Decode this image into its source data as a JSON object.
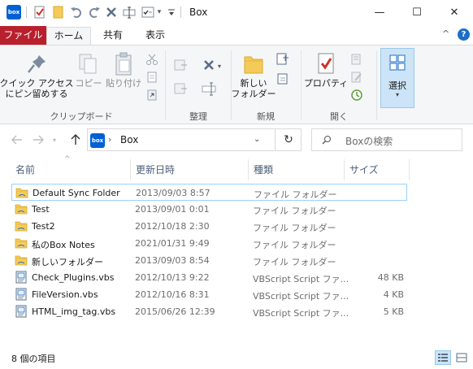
{
  "window": {
    "title": "Box",
    "minimize": "—",
    "maximize": "☐",
    "close": "✕"
  },
  "quick_access": {
    "logo_text": "box",
    "dropdown": "▾"
  },
  "tabs": {
    "file": "ファイル",
    "home": "ホーム",
    "share": "共有",
    "view": "表示",
    "collapse": "^",
    "help": "?"
  },
  "ribbon": {
    "clipboard": {
      "pin_label_line1": "クイック アクセス",
      "pin_label_line2": "にピン留めする",
      "copy_label": "コピー",
      "paste_label": "貼り付け",
      "group_label": "クリップボード"
    },
    "organize": {
      "group_label": "整理"
    },
    "new": {
      "new_folder_line1": "新しい",
      "new_folder_line2": "フォルダー",
      "group_label": "新規"
    },
    "open": {
      "properties_label": "プロパティ",
      "group_label": "開く"
    },
    "select": {
      "select_label": "選択"
    }
  },
  "address": {
    "crumb": "Box",
    "separator": "›",
    "dropdown": "⌄",
    "refresh": "↻"
  },
  "search": {
    "placeholder": "Boxの検索",
    "icon": "⌕"
  },
  "columns": {
    "name": "名前",
    "modified": "更新日時",
    "type": "種類",
    "size": "サイズ",
    "sort_caret": "^"
  },
  "files": [
    {
      "name": "Default Sync Folder",
      "modified": "2013/09/03 8:57",
      "type": "ファイル フォルダー",
      "size": "",
      "icon": "folder-icon",
      "selected": true
    },
    {
      "name": "Test",
      "modified": "2013/09/01 0:01",
      "type": "ファイル フォルダー",
      "size": "",
      "icon": "folder-icon"
    },
    {
      "name": "Test2",
      "modified": "2012/10/18 2:30",
      "type": "ファイル フォルダー",
      "size": "",
      "icon": "folder-icon"
    },
    {
      "name": "私のBox Notes",
      "modified": "2021/01/31 9:49",
      "type": "ファイル フォルダー",
      "size": "",
      "icon": "folder-icon"
    },
    {
      "name": "新しいフォルダー",
      "modified": "2013/09/03 8:54",
      "type": "ファイル フォルダー",
      "size": "",
      "icon": "folder-icon"
    },
    {
      "name": "Check_Plugins.vbs",
      "modified": "2012/10/13 9:22",
      "type": "VBScript Script ファ...",
      "size": "48 KB",
      "icon": "vbs-file-icon"
    },
    {
      "name": "FileVersion.vbs",
      "modified": "2012/10/16 8:31",
      "type": "VBScript Script ファ...",
      "size": "4 KB",
      "icon": "vbs-file-icon"
    },
    {
      "name": "HTML_img_tag.vbs",
      "modified": "2015/06/26 12:39",
      "type": "VBScript Script ファ...",
      "size": "5 KB",
      "icon": "vbs-file-icon"
    }
  ],
  "status": {
    "item_count": "8 個の項目"
  },
  "colors": {
    "file_tab": "#b9202d",
    "box_brand": "#0061d5",
    "folder": "#f4cb5a",
    "selection_border": "#99d1ff",
    "select_highlight": "#cce4f7"
  }
}
